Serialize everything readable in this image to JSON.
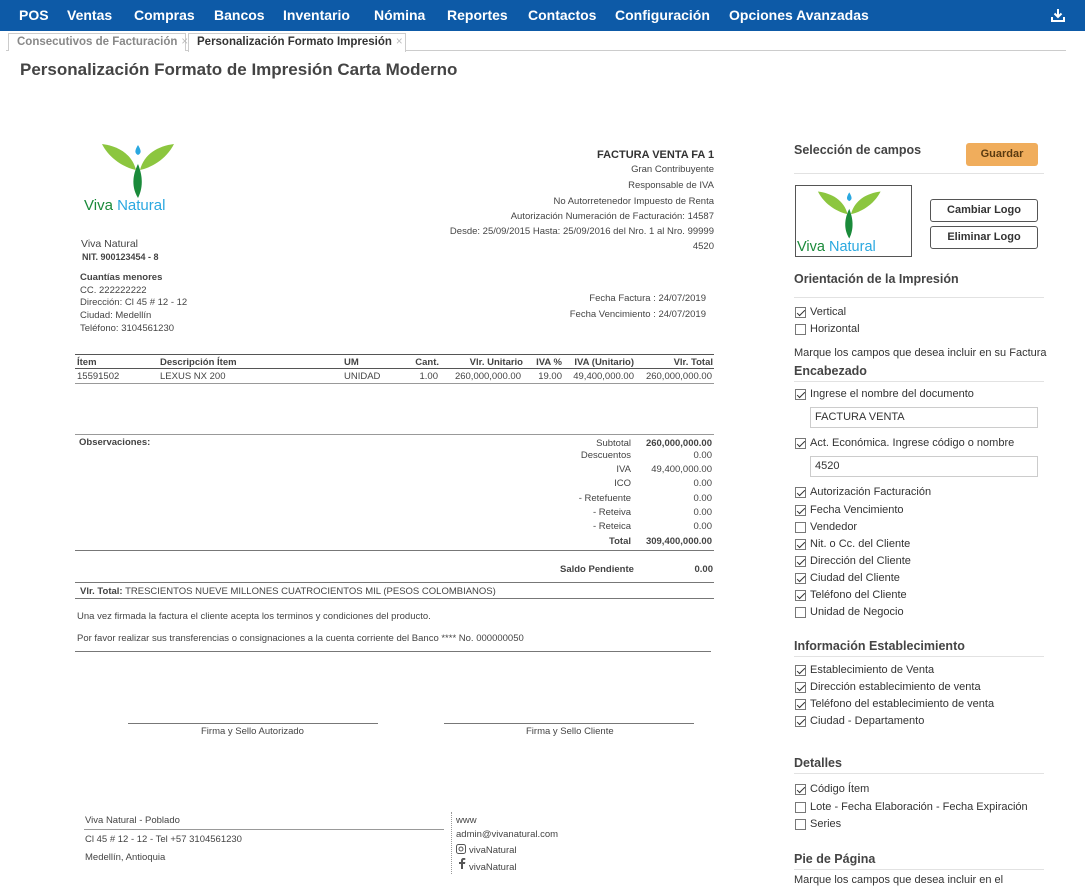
{
  "nav": {
    "items": [
      "POS",
      "Ventas",
      "Compras",
      "Bancos",
      "Inventario",
      "Nómina",
      "Reportes",
      "Contactos",
      "Configuración",
      "Opciones Avanzadas"
    ],
    "download_icon": "download-icon"
  },
  "tabs": [
    {
      "label": "Consecutivos de Facturación",
      "close": "×"
    },
    {
      "label": "Personalización Formato Impresión",
      "close": "×"
    }
  ],
  "page_title": "Personalización Formato de Impresión Carta Moderno",
  "invoice": {
    "logo_text_a": "Viva",
    "logo_text_b": "Natural",
    "doc_title": "FACTURA VENTA FA 1",
    "header_lines": [
      "Gran Contribuyente",
      "Responsable de IVA",
      "No Autorretenedor Impuesto de Renta",
      "Autorización Numeración de Facturación: 14587",
      "Desde: 25/09/2015 Hasta: 25/09/2016 del Nro. 1 al Nro. 99999",
      "4520"
    ],
    "company_name": "Viva Natural",
    "company_nit": "NIT. 900123454 - 8",
    "client_name": "Cuantías menores",
    "client_cc": "CC. 222222222",
    "client_address": "Dirección: Cl 45 # 12 - 12",
    "client_city": "Ciudad: Medellín",
    "client_phone": "Teléfono: 3104561230",
    "invoice_date": "Fecha Factura : 24/07/2019",
    "due_date": "Fecha Vencimiento : 24/07/2019",
    "table_headers": [
      "Ítem",
      "Descripción Ítem",
      "UM",
      "Cant.",
      "Vlr. Unitario",
      "IVA %",
      "IVA (Unitario)",
      "Vlr. Total"
    ],
    "table_rows": [
      [
        "15591502",
        "LEXUS NX 200",
        "UNIDAD",
        "1.00",
        "260,000,000.00",
        "19.00",
        "49,400,000.00",
        "260,000,000.00"
      ]
    ],
    "observations_label": "Observaciones:",
    "totals": [
      {
        "label": "Subtotal",
        "value": "260,000,000.00"
      },
      {
        "label": "Descuentos",
        "value": "0.00"
      },
      {
        "label": "IVA",
        "value": "49,400,000.00"
      },
      {
        "label": "ICO",
        "value": "0.00"
      },
      {
        "label": "- Retefuente",
        "value": "0.00"
      },
      {
        "label": "- Reteiva",
        "value": "0.00"
      },
      {
        "label": "- Reteica",
        "value": "0.00"
      },
      {
        "label": "Total",
        "value": "309,400,000.00"
      }
    ],
    "saldo_label": "Saldo Pendiente",
    "saldo_value": "0.00",
    "total_words_label": "Vlr. Total:",
    "total_words": "TRESCIENTOS NUEVE MILLONES CUATROCIENTOS MIL (PESOS COLOMBIANOS)",
    "terms_1": "Una vez firmada la factura el cliente acepta los terminos y condiciones del producto.",
    "terms_2": "Por favor realizar sus transferencias o consignaciones a la cuenta corriente del Banco **** No. 000000050",
    "sign_1": "Firma y Sello Autorizado",
    "sign_2": "Firma y Sello Cliente",
    "footer_left": [
      "Viva Natural - Poblado",
      "Cl 45 # 12 - 12 - Tel +57 3104561230",
      "Medellín, Antioquia"
    ],
    "footer_www": "www",
    "footer_email": "admin@vivanatural.com",
    "footer_instagram": "vivaNatural",
    "footer_facebook": "vivaNatural"
  },
  "panel": {
    "fields_title": "Selección de campos",
    "save_label": "Guardar",
    "change_logo": "Cambiar Logo",
    "remove_logo": "Eliminar Logo",
    "orientation_title": "Orientación de la Impresión",
    "orientation": [
      {
        "label": "Vertical",
        "checked": true
      },
      {
        "label": "Horizontal",
        "checked": false
      }
    ],
    "mark_note": "Marque los campos que desea incluir en su Factura",
    "header_title": "Encabezado",
    "doc_name_label": "Ingrese el nombre del documento",
    "doc_name_value": "FACTURA VENTA",
    "activity_label": "Act. Económica. Ingrese código o nombre",
    "activity_value": "4520",
    "header_fields": [
      {
        "label": "Autorización Facturación",
        "checked": true
      },
      {
        "label": "Fecha Vencimiento",
        "checked": true
      },
      {
        "label": "Vendedor",
        "checked": false
      },
      {
        "label": "Nit. o Cc. del Cliente",
        "checked": true
      },
      {
        "label": "Dirección del Cliente",
        "checked": true
      },
      {
        "label": "Ciudad del Cliente",
        "checked": true
      },
      {
        "label": "Teléfono del Cliente",
        "checked": true
      },
      {
        "label": "Unidad de Negocio",
        "checked": false
      }
    ],
    "establishment_title": "Información Establecimiento",
    "establishment_fields": [
      {
        "label": "Establecimiento de Venta",
        "checked": true
      },
      {
        "label": "Dirección establecimiento de venta",
        "checked": true
      },
      {
        "label": "Teléfono del establecimiento de venta",
        "checked": true
      },
      {
        "label": "Ciudad - Departamento",
        "checked": true
      }
    ],
    "details_title": "Detalles",
    "details_fields": [
      {
        "label": "Código Ítem",
        "checked": true
      },
      {
        "label": "Lote - Fecha Elaboración - Fecha Expiración",
        "checked": false
      },
      {
        "label": "Series",
        "checked": false
      }
    ],
    "footer_title": "Pie de Página",
    "footer_note": "Marque los campos que desea incluir en el"
  },
  "colors": {
    "nav": "#0d5aa7",
    "save": "#f0ad5c",
    "logo_green": "#8cc63f",
    "logo_dark": "#1a8a3a",
    "drop": "#2aa8e0"
  }
}
